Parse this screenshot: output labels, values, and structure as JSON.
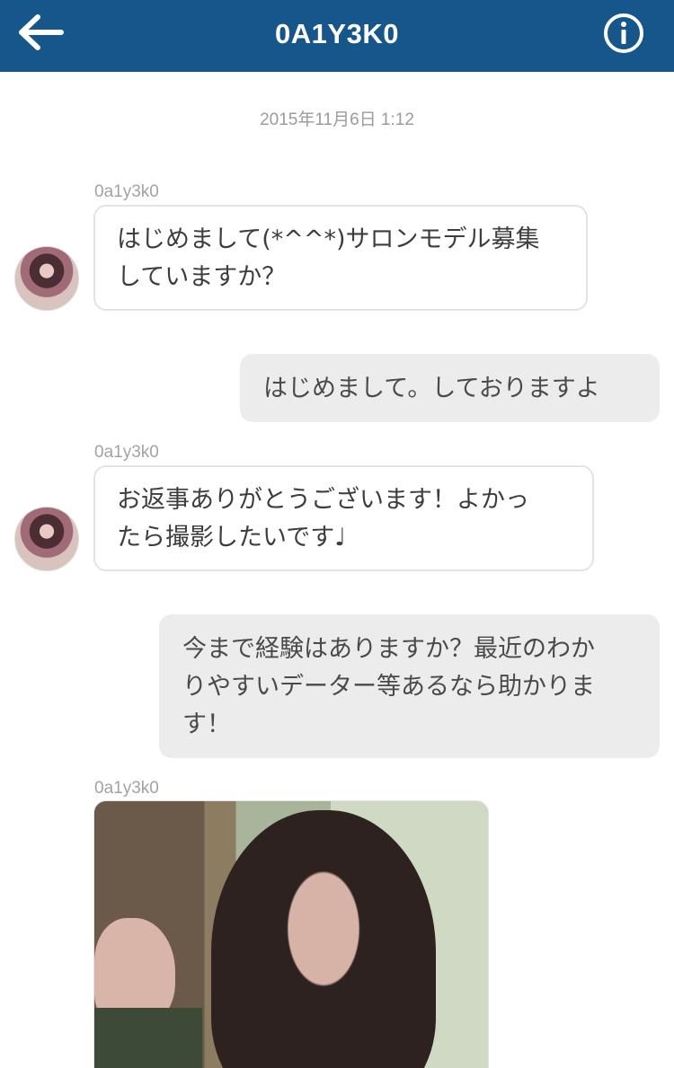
{
  "header": {
    "title": "0A1Y3K0",
    "back_icon": "arrow-left-icon",
    "info_icon": "info-circle-icon",
    "background": "#17568a"
  },
  "chat": {
    "timestamp": "2015年11月6日 1:12",
    "messages": [
      {
        "direction": "incoming",
        "sender": "0a1y3k0",
        "text_lines": [
          "はじめまして(*^^*)サロンモデル募集",
          "していますか？"
        ]
      },
      {
        "direction": "outgoing",
        "text_lines": [
          "はじめまして。しておりますよ"
        ]
      },
      {
        "direction": "incoming",
        "sender": "0a1y3k0",
        "text_lines": [
          "お返事ありがとうございます！よかっ",
          "たら撮影したいです♩"
        ]
      },
      {
        "direction": "outgoing",
        "text_lines": [
          "今まで経験はありますか？最近のわか",
          "りやすいデーター等あるなら助かりま",
          "す！"
        ]
      },
      {
        "direction": "incoming",
        "sender": "0a1y3k0",
        "attachment": "photo"
      }
    ]
  }
}
